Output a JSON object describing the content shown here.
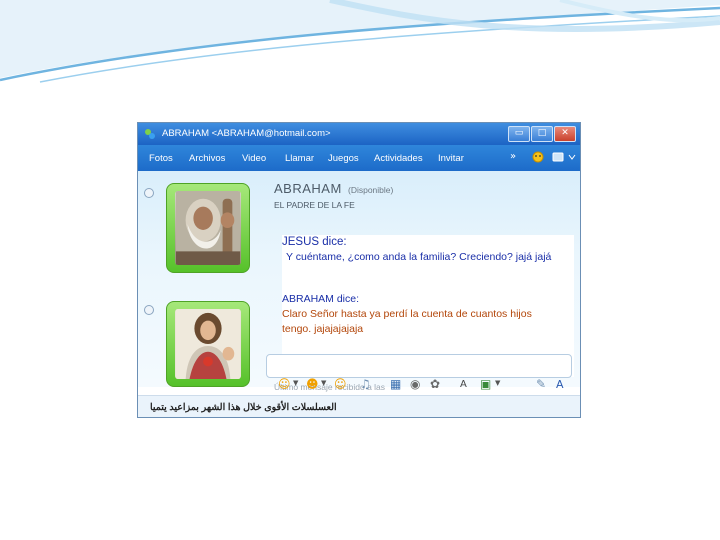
{
  "window": {
    "title": "ABRAHAM <ABRAHAM@hotmail.com>",
    "min_glyph": "▭",
    "max_glyph": "□",
    "close_glyph": "✕"
  },
  "menu": {
    "items": [
      "Fotos",
      "Archivos",
      "Video",
      "Llamar",
      "Juegos",
      "Actividades",
      "Invitar"
    ],
    "more_glyph": "»"
  },
  "contact": {
    "name": "ABRAHAM",
    "status": "(Disponible)",
    "personal_message": "EL PADRE DE LA FE"
  },
  "conversation": {
    "msg1_speaker": "JESUS dice:",
    "msg1_text": "Y cuéntame, ¿como anda la familia? Creciendo? jajá jajá",
    "msg2_speaker": "ABRAHAM dice:",
    "msg2_text": "Claro Señor hasta ya perdí la cuenta de cuantos hijos tengo. jajajajajaja"
  },
  "last_message_label": "Último mensaje recibido a las",
  "status_bar": {
    "ad_text": "العسلسلات الأقوى خلال هذا الشهر بمزاعيد يتميا"
  },
  "colors": {
    "speaker": "#1a2fa8",
    "abraham_text": "#b3470b",
    "titlebar": "#1c63c4",
    "avatar_frame": "#56c12a"
  },
  "icons": [
    "windows-live-icon",
    "smiley-icon",
    "wink-icon",
    "nudge-icon",
    "voice-clip-icon",
    "background-icon",
    "font-icon"
  ]
}
